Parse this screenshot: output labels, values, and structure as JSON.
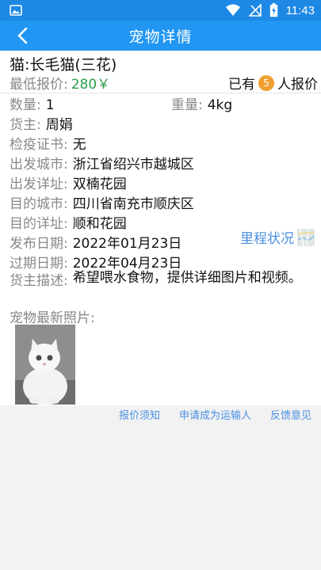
{
  "status_bar": {
    "time": "11:43",
    "icons": [
      "image-icon",
      "wifi-icon",
      "signal-icon",
      "battery-charging-icon"
    ],
    "bg_color": "#1e88e5"
  },
  "app_bar": {
    "title": "宠物详情",
    "back_icon": "back-chevron-icon",
    "bg_color": "#2196f3"
  },
  "pet": {
    "name": "猫:长毛猫(三花)",
    "price_label": "最低报价:",
    "price_value": "280￥",
    "bid_prefix": "已有",
    "bid_count": "5",
    "bid_suffix": "人报价",
    "qty_label": "数量:",
    "qty_value": "1",
    "weight_label": "重量:",
    "weight_value": "4kg",
    "owner_label": "货主:",
    "owner_value": "周娟",
    "quarantine_label": "检疫证书:",
    "quarantine_value": "无",
    "origin_city_label": "出发城市:",
    "origin_city_value": "浙江省绍兴市越城区",
    "origin_addr_label": "出发详址:",
    "origin_addr_value": "双楠花园",
    "dest_city_label": "目的城市:",
    "dest_city_value": "四川省南充市顺庆区",
    "dest_addr_label": "目的详址:",
    "dest_addr_value": "顺和花园",
    "publish_label": "发布日期:",
    "publish_value": "2022年01月23日",
    "expire_label": "过期日期:",
    "expire_value": "2022年04月23日",
    "desc_label": "货主描述:",
    "desc_value": "希望喂水食物，提供详细图片和视频。",
    "photo_label": "宠物最新照片:"
  },
  "mileage": {
    "label": "里程状况",
    "icon": "map-icon"
  },
  "footer_links": {
    "notice": "报价须知",
    "apply": "申请成为运输人",
    "feedback": "反馈意见"
  },
  "colors": {
    "accent": "#2196f3",
    "price": "#2e9e4a",
    "badge": "#f0a030",
    "link": "#4a90e2"
  }
}
